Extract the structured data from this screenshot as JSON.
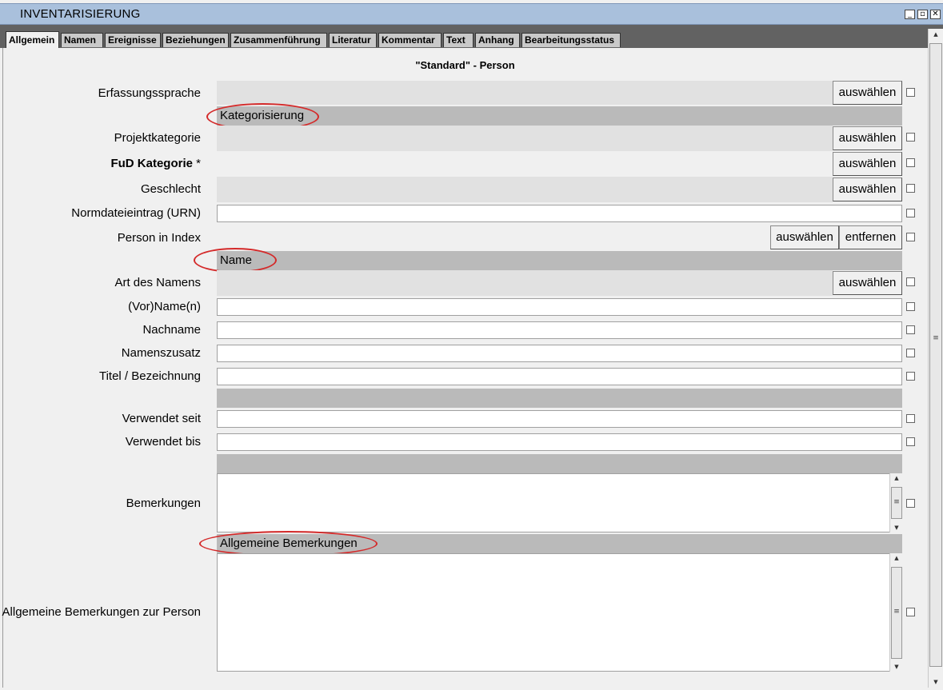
{
  "window": {
    "title": "INVENTARISIERUNG"
  },
  "tabs": [
    "Allgemein",
    "Namen",
    "Ereignisse",
    "Beziehungen",
    "Zusammenführung",
    "Literatur",
    "Kommentar",
    "Text",
    "Anhang",
    "Bearbeitungsstatus"
  ],
  "heading": "\"Standard\" - Person",
  "labels": {
    "erfassungssprache": "Erfassungssprache",
    "projektkategorie": "Projektkategorie",
    "fud_kategorie": "FuD Kategorie",
    "fud_required": " *",
    "geschlecht": "Geschlecht",
    "normdatei": "Normdateieintrag (URN)",
    "person_index": "Person in Index",
    "art_namens": "Art des Namens",
    "vorname": "(Vor)Name(n)",
    "nachname": "Nachname",
    "namenszusatz": "Namenszusatz",
    "titel": "Titel / Bezeichnung",
    "verwendet_seit": "Verwendet seit",
    "verwendet_bis": "Verwendet bis",
    "bemerkungen": "Bemerkungen",
    "allg_bemerkungen_person": "Allgemeine Bemerkungen zur Person"
  },
  "sections": {
    "kategorisierung": "Kategorisierung",
    "name": "Name",
    "allg_bemerkungen": "Allgemeine Bemerkungen"
  },
  "buttons": {
    "select": "auswählen",
    "remove": "entfernen"
  }
}
